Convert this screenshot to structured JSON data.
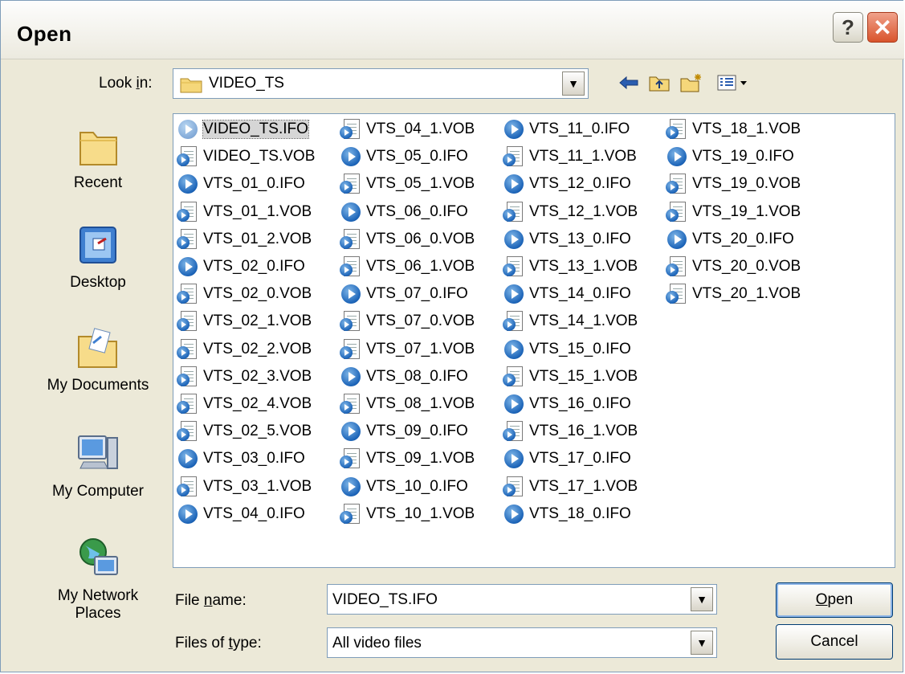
{
  "window": {
    "title": "Open",
    "help_label": "?",
    "close_label": "✕"
  },
  "toolbar": {
    "look_in_label": "Look in:",
    "look_in_value": "VIDEO_TS",
    "icons": [
      "back-icon",
      "up-folder-icon",
      "new-folder-icon",
      "view-menu-icon"
    ]
  },
  "places": [
    {
      "label": "Recent",
      "icon": "recent-folder-icon"
    },
    {
      "label": "Desktop",
      "icon": "desktop-icon"
    },
    {
      "label": "My Documents",
      "icon": "my-documents-icon"
    },
    {
      "label": "My Computer",
      "icon": "my-computer-icon"
    },
    {
      "label": "My Network Places",
      "icon": "network-places-icon"
    }
  ],
  "files": [
    {
      "name": "VIDEO_TS.IFO",
      "type": "ifo",
      "selected": true
    },
    {
      "name": "VIDEO_TS.VOB",
      "type": "vob"
    },
    {
      "name": "VTS_01_0.IFO",
      "type": "ifo"
    },
    {
      "name": "VTS_01_1.VOB",
      "type": "vob"
    },
    {
      "name": "VTS_01_2.VOB",
      "type": "vob"
    },
    {
      "name": "VTS_02_0.IFO",
      "type": "ifo"
    },
    {
      "name": "VTS_02_0.VOB",
      "type": "vob"
    },
    {
      "name": "VTS_02_1.VOB",
      "type": "vob"
    },
    {
      "name": "VTS_02_2.VOB",
      "type": "vob"
    },
    {
      "name": "VTS_02_3.VOB",
      "type": "vob"
    },
    {
      "name": "VTS_02_4.VOB",
      "type": "vob"
    },
    {
      "name": "VTS_02_5.VOB",
      "type": "vob"
    },
    {
      "name": "VTS_03_0.IFO",
      "type": "ifo"
    },
    {
      "name": "VTS_03_1.VOB",
      "type": "vob"
    },
    {
      "name": "VTS_04_0.IFO",
      "type": "ifo"
    },
    {
      "name": "VTS_04_1.VOB",
      "type": "vob"
    },
    {
      "name": "VTS_05_0.IFO",
      "type": "ifo"
    },
    {
      "name": "VTS_05_1.VOB",
      "type": "vob"
    },
    {
      "name": "VTS_06_0.IFO",
      "type": "ifo"
    },
    {
      "name": "VTS_06_0.VOB",
      "type": "vob"
    },
    {
      "name": "VTS_06_1.VOB",
      "type": "vob"
    },
    {
      "name": "VTS_07_0.IFO",
      "type": "ifo"
    },
    {
      "name": "VTS_07_0.VOB",
      "type": "vob"
    },
    {
      "name": "VTS_07_1.VOB",
      "type": "vob"
    },
    {
      "name": "VTS_08_0.IFO",
      "type": "ifo"
    },
    {
      "name": "VTS_08_1.VOB",
      "type": "vob"
    },
    {
      "name": "VTS_09_0.IFO",
      "type": "ifo"
    },
    {
      "name": "VTS_09_1.VOB",
      "type": "vob"
    },
    {
      "name": "VTS_10_0.IFO",
      "type": "ifo"
    },
    {
      "name": "VTS_10_1.VOB",
      "type": "vob"
    },
    {
      "name": "VTS_11_0.IFO",
      "type": "ifo"
    },
    {
      "name": "VTS_11_1.VOB",
      "type": "vob"
    },
    {
      "name": "VTS_12_0.IFO",
      "type": "ifo"
    },
    {
      "name": "VTS_12_1.VOB",
      "type": "vob"
    },
    {
      "name": "VTS_13_0.IFO",
      "type": "ifo"
    },
    {
      "name": "VTS_13_1.VOB",
      "type": "vob"
    },
    {
      "name": "VTS_14_0.IFO",
      "type": "ifo"
    },
    {
      "name": "VTS_14_1.VOB",
      "type": "vob"
    },
    {
      "name": "VTS_15_0.IFO",
      "type": "ifo"
    },
    {
      "name": "VTS_15_1.VOB",
      "type": "vob"
    },
    {
      "name": "VTS_16_0.IFO",
      "type": "ifo"
    },
    {
      "name": "VTS_16_1.VOB",
      "type": "vob"
    },
    {
      "name": "VTS_17_0.IFO",
      "type": "ifo"
    },
    {
      "name": "VTS_17_1.VOB",
      "type": "vob"
    },
    {
      "name": "VTS_18_0.IFO",
      "type": "ifo"
    },
    {
      "name": "VTS_18_1.VOB",
      "type": "vob"
    },
    {
      "name": "VTS_19_0.IFO",
      "type": "ifo"
    },
    {
      "name": "VTS_19_0.VOB",
      "type": "vob"
    },
    {
      "name": "VTS_19_1.VOB",
      "type": "vob"
    },
    {
      "name": "VTS_20_0.IFO",
      "type": "ifo"
    },
    {
      "name": "VTS_20_0.VOB",
      "type": "vob"
    },
    {
      "name": "VTS_20_1.VOB",
      "type": "vob"
    }
  ],
  "footer": {
    "file_name_label_pre": "File ",
    "file_name_label_key": "n",
    "file_name_label_post": "ame:",
    "file_name_value": "VIDEO_TS.IFO",
    "file_type_label_pre": "Files of ",
    "file_type_label_key": "t",
    "file_type_label_post": "ype:",
    "file_type_value": "All video files",
    "open_key": "O",
    "open_rest": "pen",
    "cancel_label": "Cancel"
  },
  "look_in_label_parts": {
    "pre": "Look ",
    "key": "i",
    "post": "n:"
  }
}
